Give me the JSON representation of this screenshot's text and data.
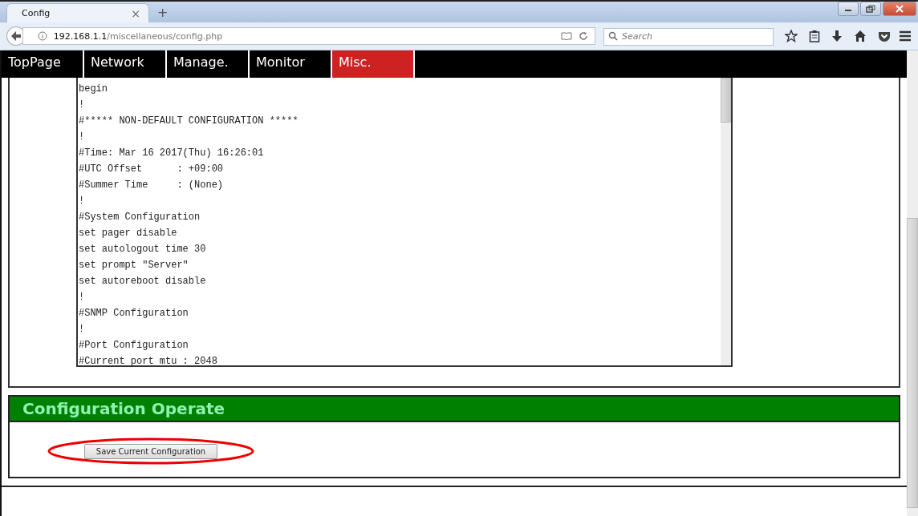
{
  "browser": {
    "tab_title": "Config",
    "tab_close": "×",
    "new_tab": "+",
    "url_host": "192.168.1.1",
    "url_path": "/miscellaneous/config.php",
    "search_placeholder": "Search"
  },
  "nav": [
    {
      "label": "TopPage",
      "selected": false
    },
    {
      "label": "Network",
      "selected": false
    },
    {
      "label": "Manage.",
      "selected": false
    },
    {
      "label": "Monitor",
      "selected": false
    },
    {
      "label": "Misc.",
      "selected": true
    }
  ],
  "config_lines": [
    "begin",
    "!",
    "#***** NON-DEFAULT CONFIGURATION *****",
    "!",
    "#Time: Mar 16 2017(Thu) 16:26:01",
    "#UTC Offset      : +09:00",
    "#Summer Time     : (None)",
    "!",
    "#System Configuration",
    "set pager disable",
    "set autologout time 30",
    "set prompt \"Server\"",
    "set autoreboot disable",
    "!",
    "#SNMP Configuration",
    "!",
    "#Port Configuration",
    "#Current port mtu : 2048"
  ],
  "operate": {
    "title": "Configuration Operate",
    "button": "Save Current Configuration",
    "highlighted": true
  }
}
